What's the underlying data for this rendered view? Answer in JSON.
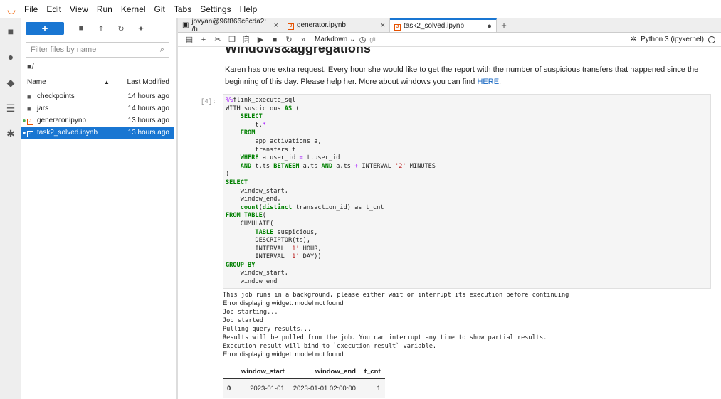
{
  "menubar": {
    "items": [
      "File",
      "Edit",
      "View",
      "Run",
      "Kernel",
      "Git",
      "Tabs",
      "Settings",
      "Help"
    ]
  },
  "sidebar": {
    "icons": [
      "folder-icon",
      "running-icon",
      "git-icon",
      "toc-icon",
      "extension-icon"
    ]
  },
  "filebrowser": {
    "new_label": "+",
    "search_placeholder": "Filter files by name",
    "breadcrumb": "/",
    "col_name": "Name",
    "col_modified": "Last Modified",
    "rows": [
      {
        "name": "checkpoints",
        "modified": "14 hours ago",
        "type": "folder"
      },
      {
        "name": "jars",
        "modified": "14 hours ago",
        "type": "folder"
      },
      {
        "name": "generator.ipynb",
        "modified": "13 hours ago",
        "type": "notebook"
      },
      {
        "name": "task2_solved.ipynb",
        "modified": "13 hours ago",
        "type": "notebook"
      }
    ]
  },
  "tabs": [
    {
      "label": "jovyan@96f866c6cda2: /h"
    },
    {
      "label": "generator.ipynb"
    },
    {
      "label": "task2_solved.ipynb"
    }
  ],
  "toolbar": {
    "cell_type": "Markdown",
    "git": "git",
    "kernel": "Python 3 (ipykernel)"
  },
  "notebook": {
    "title": "Windows&aggregations",
    "md_text": "Karen has one extra request. Every hour she would like to get the report with the number of suspicious transfers that happened since the beginning of this day. Please help her. More about windows you can find ",
    "md_link": "HERE",
    "md_end": ".",
    "prompt": "[4]:",
    "outputs": {
      "line1": "This job runs in a background, please either wait or interrupt its execution before continuing",
      "err1": "Error displaying widget: model not found",
      "log": "Job starting...\nJob started\nPulling query results...\nResults will be pulled from the job. You can interrupt any time to show partial results.\nExecution result will bind to `execution_result` variable.",
      "err2": "Error displaying widget: model not found"
    },
    "table": {
      "headers": [
        "window_start",
        "window_end",
        "t_cnt"
      ],
      "rows": [
        {
          "idx": "0",
          "window_start": "2023-01-01",
          "window_end": "2023-01-01 02:00:00",
          "t_cnt": "1"
        }
      ]
    }
  }
}
